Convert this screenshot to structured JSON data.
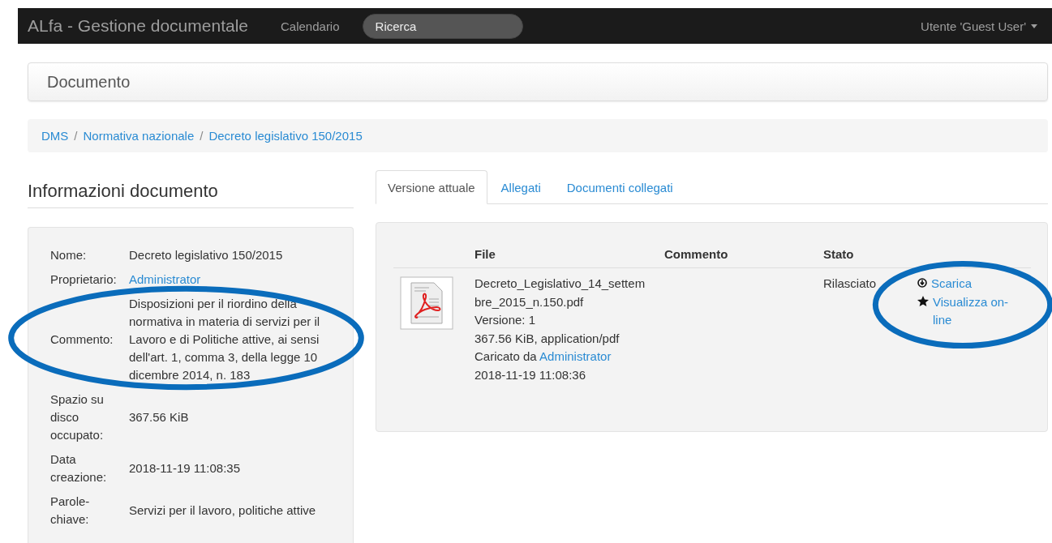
{
  "navbar": {
    "brand": "ALfa - Gestione documentale",
    "links": [
      {
        "label": "Calendario"
      }
    ],
    "search": {
      "placeholder": "Ricerca"
    },
    "user_menu": {
      "label": "Utente 'Guest User'"
    }
  },
  "page_header": {
    "title": "Documento"
  },
  "breadcrumb": {
    "separator": "/",
    "items": [
      {
        "label": "DMS"
      },
      {
        "label": "Normativa nazionale"
      },
      {
        "label": "Decreto legislativo 150/2015"
      }
    ]
  },
  "info": {
    "title": "Informazioni documento",
    "fields": [
      {
        "label": "Nome:",
        "value": "Decreto legislativo 150/2015",
        "kind": "text"
      },
      {
        "label": "Proprietario:",
        "value": "Administrator",
        "kind": "link"
      },
      {
        "label": "Commento:",
        "value": "Disposizioni per il riordino della normativa in materia di servizi per il Lavoro e di Politiche attive, ai sensi dell'art. 1, comma 3, della legge 10 dicembre 2014, n. 183",
        "kind": "text",
        "circled": true
      },
      {
        "label": "Spazio su disco occupato:",
        "value": "367.56 KiB",
        "kind": "text"
      },
      {
        "label": "Data creazione:",
        "value": "2018-11-19 11:08:35",
        "kind": "text"
      },
      {
        "label": "Parole-chiave:",
        "value": "Servizi per il lavoro, politiche attive",
        "kind": "text"
      }
    ]
  },
  "tabs": [
    {
      "label": "Versione attuale",
      "selected": true
    },
    {
      "label": "Allegati",
      "selected": false
    },
    {
      "label": "Documenti collegati",
      "selected": false
    }
  ],
  "versions": {
    "columns": [
      "File",
      "Commento",
      "Stato"
    ],
    "rows": [
      {
        "file_name": "Decreto_Legislativo_14_settembre_2015_n.150.pdf",
        "version": "Versione: 1",
        "size": "367.56 KiB, application/pdf",
        "uploaded_by_label": "Caricato da",
        "uploaded_by": "Administrator",
        "date": "2018-11-19 11:08:36",
        "status": "Rilasciato",
        "actions_circled": true,
        "actions": [
          {
            "kind": "download",
            "label": "Scarica"
          },
          {
            "kind": "star",
            "label": "Visualizza on-line"
          }
        ]
      }
    ]
  }
}
